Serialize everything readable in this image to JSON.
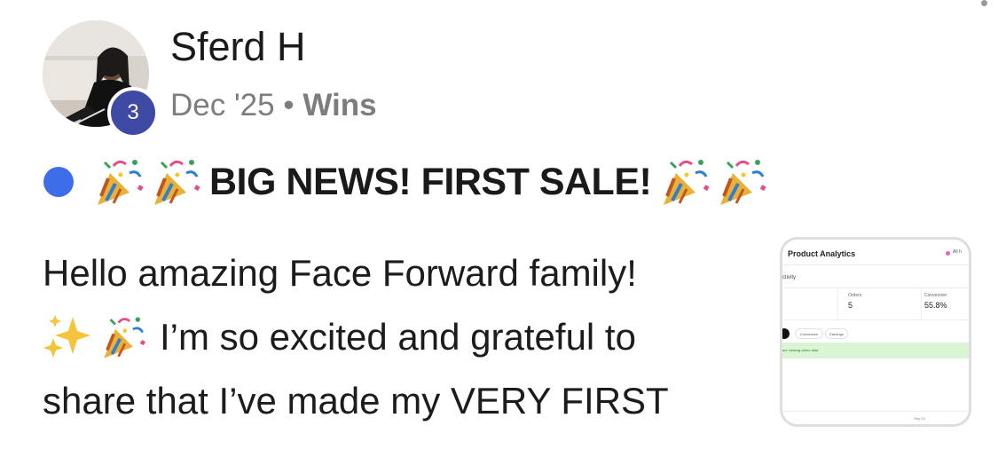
{
  "post": {
    "author": "Sferd H",
    "level": "3",
    "date": "Dec '25",
    "separator": "•",
    "category": "Wins",
    "title": "BIG NEWS! FIRST SALE!",
    "body_lines": [
      "Hello amazing Face Forward family!",
      "I’m so excited and grateful to",
      "share that I’ve made my VERY FIRST"
    ],
    "title_emojis": [
      "party-popper",
      "party-popper",
      "party-popper",
      "party-popper"
    ],
    "body_emojis": [
      "sparkles",
      "party-popper"
    ]
  },
  "thumbnail": {
    "title": "Product Analytics",
    "filter": "All h",
    "section": "ctivity",
    "metrics": [
      {
        "label": "Orders",
        "value": "5"
      },
      {
        "label": "Conversion",
        "value": "55.8%"
      }
    ],
    "tabs": [
      "Conversion",
      "Earnings"
    ],
    "banner": "are viewing demo data",
    "axis_date": "Sep 24"
  },
  "colors": {
    "unread_dot": "#3d6de8",
    "level_badge": "#3f4aa5",
    "meta_text": "#7d7d7d",
    "demo_banner": "#d9f5d3"
  }
}
